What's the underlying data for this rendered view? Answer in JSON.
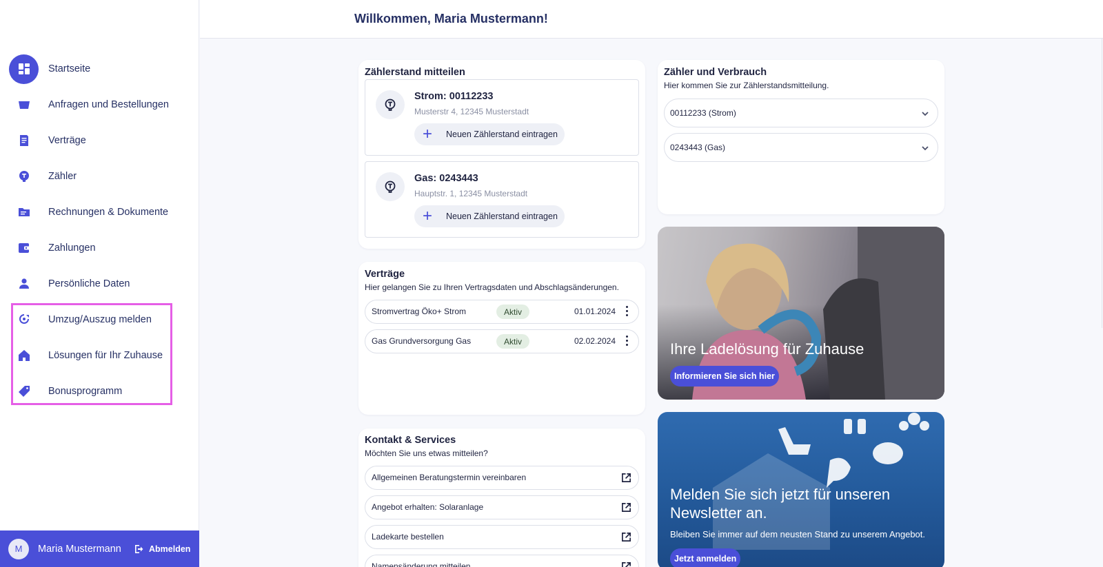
{
  "header": {
    "title": "Willkommen, Maria Mustermann!"
  },
  "sidebar": {
    "items": [
      {
        "label": "Startseite",
        "icon": "dashboard-icon",
        "active": true
      },
      {
        "label": "Anfragen und Bestellungen",
        "icon": "basket-icon"
      },
      {
        "label": "Verträge",
        "icon": "contract-icon"
      },
      {
        "label": "Zähler",
        "icon": "meter-icon"
      },
      {
        "label": "Rechnungen & Dokumente",
        "icon": "folder-icon"
      },
      {
        "label": "Zahlungen",
        "icon": "wallet-icon"
      },
      {
        "label": "Persönliche Daten",
        "icon": "person-icon"
      },
      {
        "label": "Umzug/Auszug melden",
        "icon": "move-icon"
      },
      {
        "label": "Lösungen für Ihr Zuhause",
        "icon": "home-icon"
      },
      {
        "label": "Bonusprogramm",
        "icon": "tag-icon"
      }
    ],
    "user": {
      "initial": "M",
      "name": "Maria Mustermann",
      "logout_label": "Abmelden"
    }
  },
  "meter_reading": {
    "title": "Zählerstand mitteilen",
    "meters": [
      {
        "title": "Strom: 00112233",
        "address": "Musterstr 4, 12345 Musterstadt",
        "button": "Neuen Zählerstand eintragen"
      },
      {
        "title": "Gas: 0243443",
        "address": "Hauptstr.  1, 12345 Musterstadt",
        "button": "Neuen Zählerstand eintragen"
      }
    ]
  },
  "contracts": {
    "title": "Verträge",
    "subtitle": "Hier gelangen Sie zu Ihren Vertragsdaten und Abschlagsänderungen.",
    "rows": [
      {
        "name": "Stromvertrag Öko+ Strom",
        "status": "Aktiv",
        "date": "01.01.2024"
      },
      {
        "name": "Gas Grundversorgung Gas",
        "status": "Aktiv",
        "date": "02.02.2024"
      }
    ]
  },
  "services": {
    "title": "Kontakt & Services",
    "subtitle": "Möchten Sie uns etwas mitteilen?",
    "rows": [
      "Allgemeinen Beratungstermin vereinbaren",
      "Angebot erhalten: Solaranlage",
      "Ladekarte bestellen",
      "Namensänderung mitteilen"
    ]
  },
  "consumption": {
    "title": "Zähler und Verbrauch",
    "subtitle": "Hier kommen Sie zur Zählerstandsmitteilung.",
    "selects": [
      "00112233 (Strom)",
      "0243443 (Gas)"
    ]
  },
  "promos": {
    "charging": {
      "title": "Ihre Ladelösung für Zuhause",
      "button": "Informieren Sie sich hier"
    },
    "newsletter": {
      "title": "Melden Sie sich jetzt für unseren Newsletter an.",
      "subtitle": "Bleiben Sie immer auf dem neusten Stand zu unserem Angebot.",
      "button": "Jetzt anmelden"
    }
  },
  "colors": {
    "accent": "#4a4fd8",
    "highlight": "#e55ee6",
    "badge_bg": "#e3eee3"
  }
}
